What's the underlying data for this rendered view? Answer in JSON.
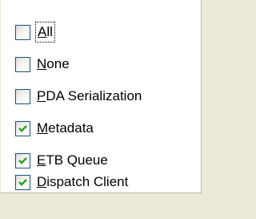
{
  "options": [
    {
      "accel": "A",
      "rest": "ll",
      "checked": false,
      "focused": true
    },
    {
      "accel": "N",
      "rest": "one",
      "checked": false,
      "focused": false
    },
    {
      "accel": "P",
      "rest": "DA Serialization",
      "checked": false,
      "focused": false
    },
    {
      "accel": "M",
      "rest": "etadata",
      "checked": true,
      "focused": false
    },
    {
      "accel": "E",
      "rest": "TB Queue",
      "checked": true,
      "focused": false
    },
    {
      "accel": "D",
      "rest": "ispatch Client",
      "checked": true,
      "focused": false
    }
  ],
  "colors": {
    "check_mark": "#21a121",
    "checkbox_border": "#1c5180",
    "panel_background": "#ffffff",
    "window_background": "#ece9d8"
  },
  "icons": {
    "check": "checkmark-icon"
  }
}
